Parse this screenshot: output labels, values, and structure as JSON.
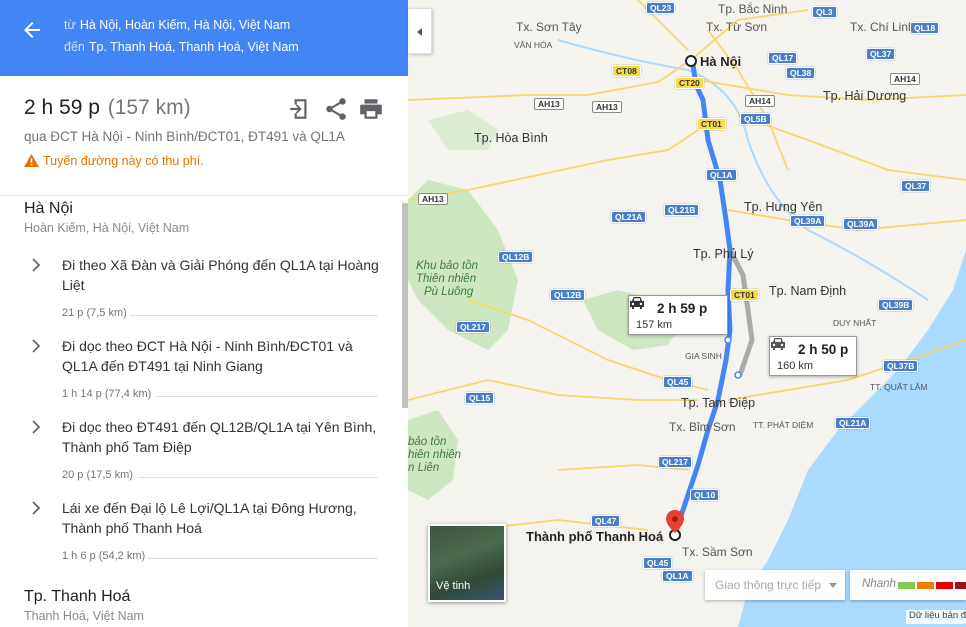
{
  "header": {
    "from_prefix": "từ",
    "from_place": "Hà Nội, Hoàn Kiếm, Hà Nội, Việt Nam",
    "to_prefix": "đến",
    "to_place": "Tp. Thanh Hoá, Thanh Hoá, Việt Nam"
  },
  "summary": {
    "duration": "2 h 59 p",
    "distance": "(157 km)",
    "via": "qua ĐCT Hà Nội - Ninh Bình/ĐCT01, ĐT491 và QL1A",
    "toll_warning": "Tuyến đường này có thu phí.",
    "warning_color": "#e37400"
  },
  "origin": {
    "name": "Hà Nội",
    "address": "Hoàn Kiếm, Hà Nội, Việt Nam"
  },
  "steps": [
    {
      "text": "Đi theo Xã Đàn và Giải Phóng đến QL1A tại Hoàng Liệt",
      "distance": "21 p (7,5 km)"
    },
    {
      "text": "Đi dọc theo ĐCT Hà Nội - Ninh Bình/ĐCT01 và QL1A đến ĐT491 tại Ninh Giang",
      "distance": "1 h 14 p (77,4 km)"
    },
    {
      "text": "Đi dọc theo ĐT491 đến QL12B/QL1A tại Yên Bình, Thành phố Tam Điệp",
      "distance": "20 p (17,5 km)"
    },
    {
      "text": "Lái xe đến Đại lộ Lê Lợi/QL1A tại Đông Hương, Thành phố Thanh Hoá",
      "distance": "1 h 6 p (54,2 km)"
    }
  ],
  "destination": {
    "name": "Tp. Thanh Hoá",
    "address": "Thanh Hoá, Việt Nam"
  },
  "map": {
    "cities": [
      "Hà Nội",
      "Tp. Hòa Bình",
      "Tp. Hưng Yên",
      "Tp. Phủ Lý",
      "Tp. Nam Định",
      "Tp. Hải Dương",
      "Tp. Bắc Ninh",
      "Tx. Từ Sơn",
      "Tx. Sơn Tây",
      "Tx. Chí Linh",
      "Tp. Tam Điệp",
      "Tx. Bỉm Sơn",
      "Tx. Sầm Sơn",
      "Thành phố Thanh Hoá"
    ],
    "small_labels": [
      "VĂN HÓA",
      "GIA SINH",
      "DUY NHẤT",
      "TT. QUẤT LÂM",
      "TT. PHÁT DIỆM"
    ],
    "park_1": [
      "Khu bảo tồn",
      "Thiên nhiên",
      "Pù Luông"
    ],
    "park_2": [
      "bảo tồn",
      "hiên nhiên",
      "n Liên"
    ],
    "shields": [
      "QL23",
      "QL3",
      "QL18",
      "CT08",
      "CT20",
      "QL17",
      "QL38",
      "QL37",
      "AH14",
      "AH13",
      "AH13",
      "AH14",
      "QL5B",
      "CT01",
      "AH13",
      "QL1A",
      "QL21A",
      "QL21B",
      "QL39A",
      "QL39A",
      "QL12B",
      "QL12B",
      "QL217",
      "CT01",
      "QL39B",
      "QL45",
      "QL15",
      "QL37B",
      "QL21A",
      "QL217",
      "QL10",
      "QL47",
      "QL45",
      "QL1A",
      "QL37"
    ],
    "route_main": {
      "duration": "2 h 59 p",
      "distance": "157 km"
    },
    "route_alt": {
      "duration": "2 h 50 p",
      "distance": "160 km"
    },
    "satellite_label": "Vệ tinh",
    "traffic_placeholder": "Giao thông trực tiếp",
    "traffic_fast": "Nhanh",
    "traffic_colors": [
      "#84ca50",
      "#f07d02",
      "#e60000",
      "#9e1313"
    ],
    "map_data": "Dữ liệu bản đồ",
    "route_color": "#4285f4",
    "alt_route_color": "#aaaaaa"
  }
}
